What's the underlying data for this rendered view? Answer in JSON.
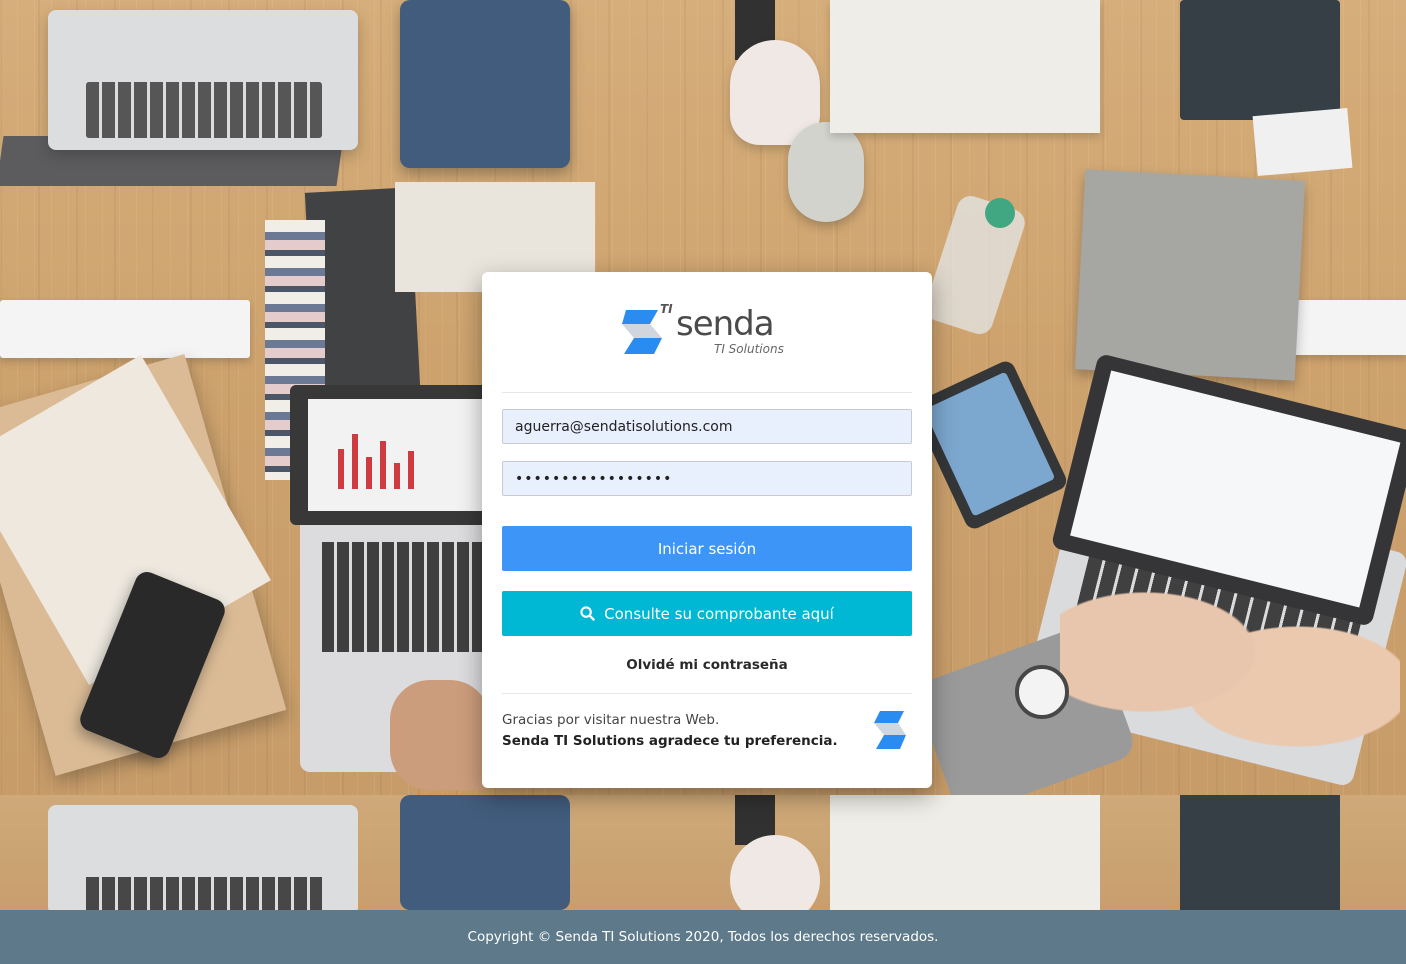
{
  "brand": {
    "logo_superscript": "TI",
    "logo_name": "senda",
    "logo_subtitle": "TI Solutions",
    "colors": {
      "blue": "#3d96f7",
      "cyan": "#00b8d4",
      "footer": "#5e7a8a"
    }
  },
  "form": {
    "email_value": "aguerra@sendatisolutions.com",
    "password_value": "•••••••••••••••••",
    "login_label": "Iniciar sesión",
    "consult_label": "Consulte su comprobante aquí",
    "consult_icon": "search-icon",
    "forgot_label": "Olvidé mi contraseña"
  },
  "thanks": {
    "line1": "Gracias por visitar nuestra Web.",
    "line2": "Senda TI Solutions agradece tu preferencia."
  },
  "footer": {
    "copyright": "Copyright © Senda TI Solutions 2020, Todos los derechos reservados."
  }
}
